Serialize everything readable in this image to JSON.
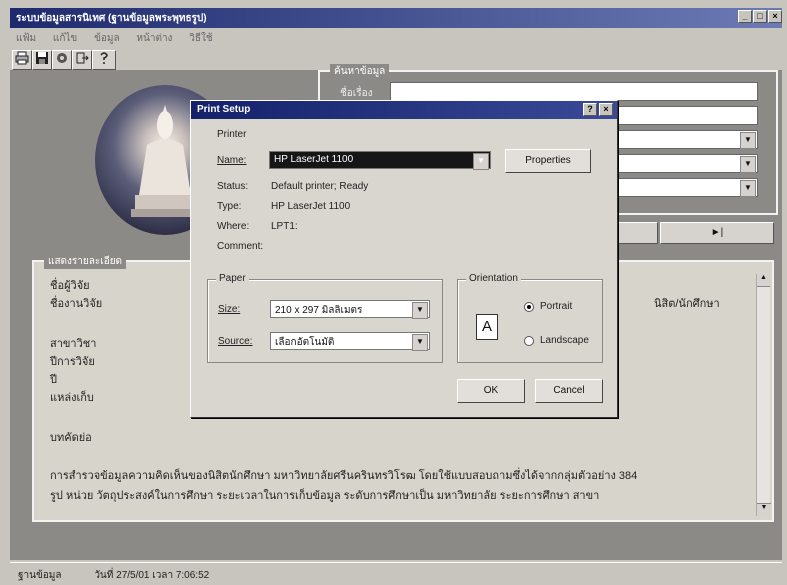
{
  "window": {
    "title": "ระบบข้อมูลสารนิเทศ (ฐานข้อมูลพระพุทธรูป)",
    "controls": [
      "_",
      "□",
      "×"
    ]
  },
  "menu": [
    "แฟ้ม",
    "แก้ไข",
    "ข้อมูล",
    "หน้าต่าง",
    "วิธีใช้"
  ],
  "toolbar": [
    "print-icon",
    "save-icon",
    "gear-icon",
    "exit-icon",
    "help-icon"
  ],
  "search_group": {
    "label": "ค้นหาข้อมูล",
    "first_label": "ชื่อเรื่อง"
  },
  "nav": {
    "next_label": "►|"
  },
  "detail": {
    "label": "แสดงรายละเอียด",
    "rows": [
      "ชื่อผู้วิจัย",
      "ชื่องานวิจัย",
      "สาขาวิชา",
      "ปีการวิจัย",
      "ปี",
      "แหล่งเก็บ",
      "บทคัดย่อ"
    ],
    "right_fragment": "นิสิต/นักศึกษา",
    "abstract_line1": "การสำรวจข้อมูลความคิดเห็นของนิสิตนักศึกษา มหาวิทยาลัยศรีนครินทรวิโรฒ โดยใช้แบบสอบถามซึ่งได้จากกลุ่มตัวอย่าง 384",
    "abstract_line2": "รูป หน่วย วัตถุประสงค์ในการศึกษา ระยะเวลาในการเก็บข้อมูล ระดับการศึกษาเป็น มหาวิทยาลัย ระยะการศึกษา สาขา"
  },
  "status": {
    "app": "ฐานข้อมูล",
    "date": "วันที่ 27/5/01 เวลา 7:06:52"
  },
  "dialog": {
    "title": "Print Setup",
    "title_buttons": [
      "?",
      "×"
    ],
    "printer_label": "Printer",
    "name_label": "Name:",
    "name_value": "HP LaserJet 1100",
    "properties_label": "Properties",
    "status_label": "Status:",
    "status_value": "Default printer; Ready",
    "type_label": "Type:",
    "type_value": "HP LaserJet 1100",
    "where_label": "Where:",
    "where_value": "LPT1:",
    "comment_label": "Comment:",
    "paper_label": "Paper",
    "size_label": "Size:",
    "size_value": "210 x 297 มิลลิเมตร",
    "source_label": "Source:",
    "source_value": "เลือกอัตโนมัติ",
    "orientation_label": "Orientation",
    "portrait_label": "Portrait",
    "landscape_label": "Landscape",
    "orientation_icon_letter": "A",
    "ok_label": "OK",
    "cancel_label": "Cancel"
  }
}
